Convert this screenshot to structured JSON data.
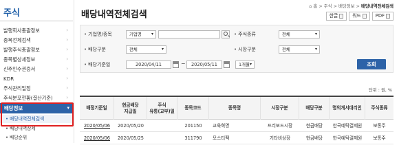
{
  "sidebar": {
    "title": "주식",
    "items": [
      {
        "label": "발행회사총괄정보"
      },
      {
        "label": "종목전체검색"
      },
      {
        "label": "발행주식총괄정보"
      },
      {
        "label": "종목별상세정보"
      },
      {
        "label": "신주인수권증서"
      },
      {
        "label": "KDR"
      },
      {
        "label": "주식관리일정"
      },
      {
        "label": "주식분포현황(결산기준)"
      }
    ],
    "chevron": "›",
    "active": {
      "label": "배당정보",
      "chevron": "▾"
    },
    "sub_items": [
      {
        "label": "• 배당내역전체검색",
        "selected": true
      },
      {
        "label": "• 배당내역상세",
        "selected": false
      },
      {
        "label": "• 배당순위",
        "selected": false
      }
    ]
  },
  "header": {
    "title": "배당내역전체검색",
    "breadcrumb": {
      "home_icon": "home-icon",
      "parts": [
        "홈",
        "주식",
        "배당정보"
      ],
      "current": "배당내역전체검색",
      "sep": ">"
    },
    "buttons": [
      {
        "label": "한글",
        "icon": "hwp-icon"
      },
      {
        "label": "워드",
        "icon": "word-icon"
      },
      {
        "label": "PDF",
        "icon": "pdf-icon"
      }
    ]
  },
  "search": {
    "company_label": "기업명/종목",
    "company_select": "기업명",
    "company_input": "",
    "stock_type_label": "주식종류",
    "stock_type_value": "전체",
    "dividend_type_label": "배당구분",
    "dividend_type_value": "전체",
    "market_label": "시장구분",
    "market_value": "전체",
    "date_label": "배당기준일",
    "date_from": "2020/04/11",
    "date_to": "2020/05/11",
    "date_sep": "~",
    "period_value": "1개월",
    "submit_label": "조회"
  },
  "unit_text": "단위 : 원, %",
  "table": {
    "headers": [
      "배정기준일",
      "현금배당\n지급일",
      "주식\n유통(교부)일",
      "종목코드",
      "종목명",
      "시장구분",
      "배당구분",
      "명의개서대리인",
      "주식종류"
    ],
    "rows": [
      [
        "2020/05/06",
        "2020/05/20",
        "",
        "201150",
        "교육혁명",
        "프리보드시장",
        "현금배당",
        "한국예탁결제원",
        "보통주"
      ],
      [
        "2020/05/06",
        "2020/05/25",
        "",
        "311790",
        "모스티팩",
        "기타비상장",
        "현금배당",
        "한국예탁결제원",
        "보통주"
      ]
    ]
  },
  "colors": {
    "accent": "#2d63a8",
    "highlight_border": "#e02020"
  }
}
